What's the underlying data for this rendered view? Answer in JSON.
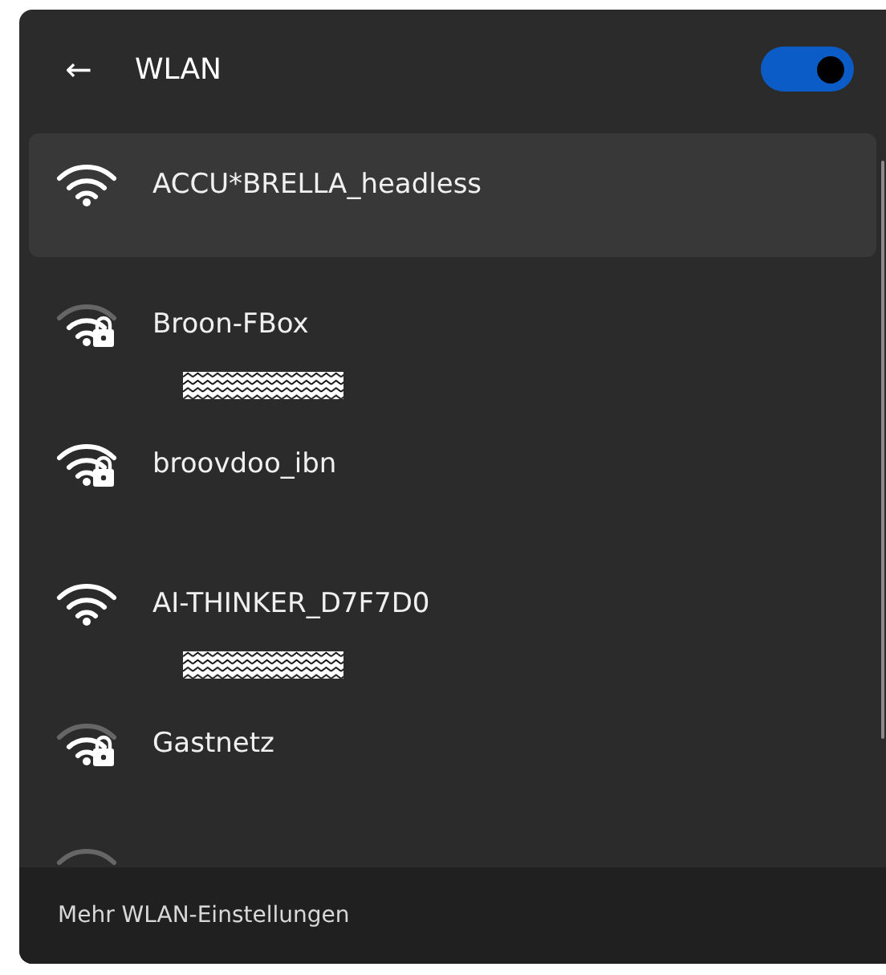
{
  "header": {
    "back_icon": "←",
    "title": "WLAN",
    "toggle_on": true
  },
  "networks": [
    {
      "name": "ACCU*BRELLA_headless",
      "kind": "strong",
      "secured": false,
      "selected": true,
      "redacted": false
    },
    {
      "name": "Broon-FBox",
      "kind": "medium",
      "secured": true,
      "selected": false,
      "redacted": true
    },
    {
      "name": "broovdoo_ibn",
      "kind": "strong",
      "secured": true,
      "selected": false,
      "redacted": false
    },
    {
      "name": "AI-THINKER_D7F7D0",
      "kind": "strong",
      "secured": false,
      "selected": false,
      "redacted": true
    },
    {
      "name": "Gastnetz",
      "kind": "medium",
      "secured": true,
      "selected": false,
      "redacted": false
    }
  ],
  "footer": {
    "link": "Mehr WLAN-Einstellungen"
  }
}
